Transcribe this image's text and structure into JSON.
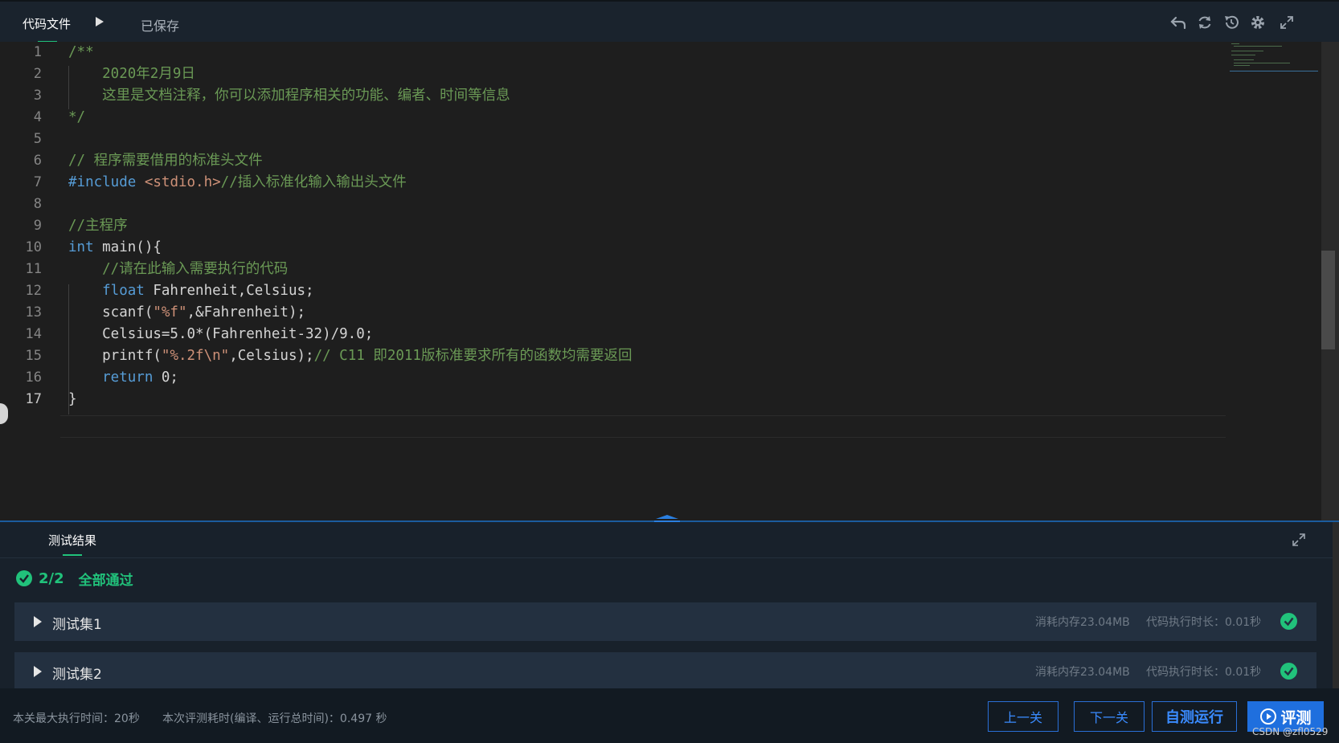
{
  "topbar": {
    "file_tab": "代码文件",
    "saved_status": "已保存",
    "toolbar_icons": [
      "undo-icon",
      "refresh-icon",
      "restore-icon",
      "settings-icon",
      "fullscreen-icon"
    ]
  },
  "editor": {
    "line_numbers": [
      "1",
      "2",
      "3",
      "4",
      "5",
      "6",
      "7",
      "8",
      "9",
      "10",
      "11",
      "12",
      "13",
      "14",
      "15",
      "16",
      "17"
    ],
    "active_line": "17",
    "code": {
      "l1": "/**",
      "l2": "    2020年2月9日",
      "l3": "    这里是文档注释，你可以添加程序相关的功能、编者、时间等信息",
      "l4": "*/",
      "l6": "// 程序需要借用的标准头文件",
      "l7_kw": "#include",
      "l7_hdr": " <stdio.h>",
      "l7_cmt": "//插入标准化输入输出头文件",
      "l9": "//主程序",
      "l10_kw": "int",
      "l10_rest": " main(){",
      "l11": "    //请在此输入需要执行的代码",
      "l12_kw": "    float",
      "l12_rest": " Fahrenheit,Celsius;",
      "l13_a": "    scanf(",
      "l13_str": "\"%f\"",
      "l13_b": ",&Fahrenheit);",
      "l14": "    Celsius=5.0*(Fahrenheit-32)/9.0;",
      "l15_a": "    printf(",
      "l15_str": "\"%.2f\\n\"",
      "l15_b": ",Celsius);",
      "l15_cmt": "// C11 即2011版标准要求所有的函数均需要返回",
      "l16_kw": "    return",
      "l16_rest": " 0;",
      "l17": "}"
    }
  },
  "results": {
    "tab_label": "测试结果",
    "count": "2/2",
    "all_pass": "全部通过",
    "testcases": [
      {
        "name": "测试集1",
        "memory": "消耗内存23.04MB",
        "time": "代码执行时长：0.01秒"
      },
      {
        "name": "测试集2",
        "memory": "消耗内存23.04MB",
        "time": "代码执行时长：0.01秒"
      }
    ]
  },
  "footer": {
    "max_time": "本关最大执行时间：20秒",
    "eval_time": "本次评测耗时(编译、运行总时间)：0.497 秒",
    "prev_label": "上一关",
    "next_label": "下一关",
    "self_test_label": "自测运行",
    "evaluate_label": "评测"
  },
  "watermark": "CSDN @zfl0529",
  "colors": {
    "accent_green": "#21c27b",
    "accent_blue": "#1f6fde",
    "comment": "#6a9955",
    "keyword": "#569cd6",
    "string": "#ce9178"
  }
}
